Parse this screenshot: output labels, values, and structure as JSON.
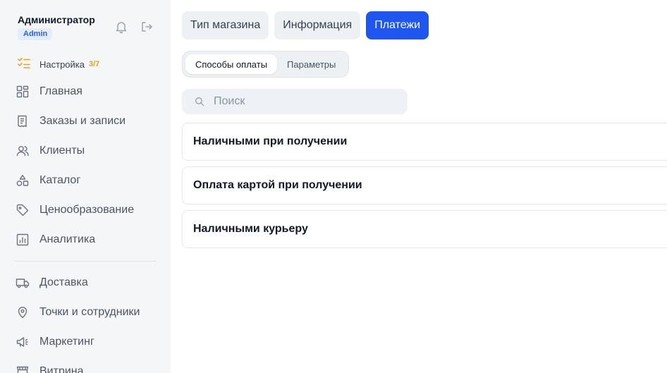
{
  "user": {
    "name": "Администратор",
    "role": "Admin"
  },
  "setup": {
    "label": "Настройка",
    "progress": "3/7"
  },
  "nav_primary": [
    {
      "label": "Главная",
      "icon": "grid-icon"
    },
    {
      "label": "Заказы и записи",
      "icon": "receipt-icon"
    },
    {
      "label": "Клиенты",
      "icon": "users-icon"
    },
    {
      "label": "Каталог",
      "icon": "shapes-icon"
    },
    {
      "label": "Ценообразование",
      "icon": "tag-icon"
    },
    {
      "label": "Аналитика",
      "icon": "chart-icon"
    }
  ],
  "nav_secondary": [
    {
      "label": "Доставка",
      "icon": "truck-icon"
    },
    {
      "label": "Точки и сотрудники",
      "icon": "location-pin-icon"
    },
    {
      "label": "Маркетинг",
      "icon": "megaphone-icon"
    },
    {
      "label": "Витрина",
      "icon": "storefront-icon"
    }
  ],
  "tabs": [
    {
      "label": "Тип магазина",
      "active": false
    },
    {
      "label": "Информация",
      "active": false
    },
    {
      "label": "Платежи",
      "active": true
    }
  ],
  "subtabs": [
    {
      "label": "Способы оплаты",
      "active": true
    },
    {
      "label": "Параметры",
      "active": false
    }
  ],
  "search": {
    "placeholder": "Поиск",
    "value": ""
  },
  "payment_methods": [
    "Наличными при получении",
    "Оплата картой при получении",
    "Наличными курьеру"
  ],
  "colors": {
    "accent": "#1f56f0",
    "setup_accent": "#e5a11a",
    "sidebar_bg": "#f5f6f8"
  }
}
